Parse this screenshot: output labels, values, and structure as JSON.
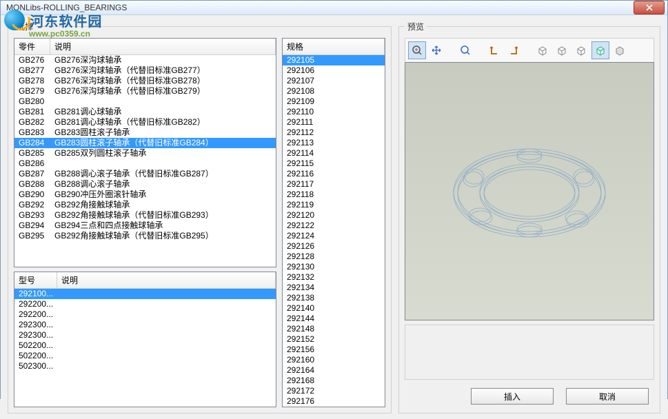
{
  "window": {
    "title": "MONLibs-ROLLING_BEARINGS"
  },
  "watermark": {
    "main": "河东软件园",
    "url": "www.pc0359.cn"
  },
  "select_panel": {
    "legend": "选择"
  },
  "preview_panel": {
    "legend": "预览"
  },
  "parts": {
    "header": {
      "col1": "零件",
      "col2": "说明"
    },
    "rows": [
      {
        "code": "GB276",
        "desc": "GB276深沟球轴承"
      },
      {
        "code": "GB277",
        "desc": "GB276深沟球轴承（代替旧标准GB277）"
      },
      {
        "code": "GB278",
        "desc": "GB276深沟球轴承（代替旧标准GB278）"
      },
      {
        "code": "GB279",
        "desc": "GB276深沟球轴承（代替旧标准GB279）"
      },
      {
        "code": "GB280",
        "desc": ""
      },
      {
        "code": "GB281",
        "desc": "GB281调心球轴承"
      },
      {
        "code": "GB282",
        "desc": "GB281调心球轴承（代替旧标准GB282）"
      },
      {
        "code": "GB283",
        "desc": "GB283圆柱滚子轴承"
      },
      {
        "code": "GB284",
        "desc": "GB283圆柱滚子轴承（代替旧标准GB284）",
        "selected": true
      },
      {
        "code": "GB285",
        "desc": "GB285双列圆柱滚子轴承"
      },
      {
        "code": "GB286",
        "desc": ""
      },
      {
        "code": "GB287",
        "desc": "GB288调心滚子轴承（代替旧标准GB287）"
      },
      {
        "code": "GB288",
        "desc": "GB288调心滚子轴承"
      },
      {
        "code": "GB290",
        "desc": "GB290冲压外圈滚针轴承"
      },
      {
        "code": "GB292",
        "desc": "GB292角接触球轴承"
      },
      {
        "code": "GB293",
        "desc": "GB292角接触球轴承（代替旧标准GB293）"
      },
      {
        "code": "GB294",
        "desc": "GB294三点和四点接触球轴承"
      },
      {
        "code": "GB295",
        "desc": "GB292角接触球轴承（代替旧标准GB295）"
      }
    ]
  },
  "models": {
    "header": {
      "col1": "型号",
      "col2": "说明"
    },
    "rows": [
      {
        "code": "292100...",
        "desc": "",
        "selected": true
      },
      {
        "code": "292200...",
        "desc": ""
      },
      {
        "code": "292200...",
        "desc": ""
      },
      {
        "code": "292300...",
        "desc": ""
      },
      {
        "code": "292300...",
        "desc": ""
      },
      {
        "code": "502200...",
        "desc": ""
      },
      {
        "code": "502200...",
        "desc": ""
      },
      {
        "code": "502300...",
        "desc": ""
      }
    ]
  },
  "specs": {
    "header": {
      "col1": "规格"
    },
    "rows": [
      {
        "code": "292105",
        "selected": true
      },
      {
        "code": "292106"
      },
      {
        "code": "292107"
      },
      {
        "code": "292108"
      },
      {
        "code": "292109"
      },
      {
        "code": "292110"
      },
      {
        "code": "292111"
      },
      {
        "code": "292112"
      },
      {
        "code": "292113"
      },
      {
        "code": "292114"
      },
      {
        "code": "292115"
      },
      {
        "code": "292116"
      },
      {
        "code": "292117"
      },
      {
        "code": "292118"
      },
      {
        "code": "292119"
      },
      {
        "code": "292120"
      },
      {
        "code": "292122"
      },
      {
        "code": "292124"
      },
      {
        "code": "292126"
      },
      {
        "code": "292128"
      },
      {
        "code": "292130"
      },
      {
        "code": "292132"
      },
      {
        "code": "292134"
      },
      {
        "code": "292138"
      },
      {
        "code": "292140"
      },
      {
        "code": "292144"
      },
      {
        "code": "292148"
      },
      {
        "code": "292152"
      },
      {
        "code": "292156"
      },
      {
        "code": "292160"
      },
      {
        "code": "292164"
      },
      {
        "code": "292168"
      },
      {
        "code": "292172"
      },
      {
        "code": "292176"
      }
    ]
  },
  "toolbar": {
    "icons": [
      "zoom-fit",
      "pan",
      "zoom-area",
      "view-front",
      "view-side",
      "iso-1",
      "iso-2",
      "iso-3",
      "wireframe",
      "shaded"
    ]
  },
  "buttons": {
    "insert": "插入",
    "cancel": "取消"
  }
}
